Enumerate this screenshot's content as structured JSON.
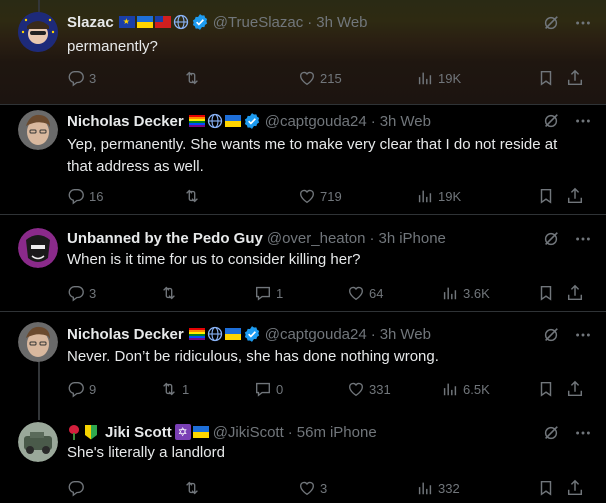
{
  "tweets": [
    {
      "name": "Slazac",
      "handle": "@TrueSlazac",
      "time": "3h",
      "source": "Web",
      "text": "permanently?",
      "replies": "3",
      "retweets": "",
      "quotes": "",
      "likes": "215",
      "views": "19K"
    },
    {
      "name": "Nicholas Decker",
      "handle": "@captgouda24",
      "time": "3h",
      "source": "Web",
      "text": "Yep, permanently. She wants me to make very clear that I do not reside at that address as well.",
      "replies": "16",
      "retweets": "",
      "quotes": "",
      "likes": "719",
      "views": "19K"
    },
    {
      "name": "Unbanned by the Pedo Guy",
      "handle": "@over_heaton",
      "time": "3h",
      "source": "iPhone",
      "text": "When is it time for us to consider killing her?",
      "replies": "3",
      "retweets": "",
      "quotes": "1",
      "likes": "64",
      "views": "3.6K"
    },
    {
      "name": "Nicholas Decker",
      "handle": "@captgouda24",
      "time": "3h",
      "source": "Web",
      "text": "Never. Don’t be ridiculous, she has done nothing wrong.",
      "replies": "9",
      "retweets": "1",
      "quotes": "0",
      "likes": "331",
      "views": "6.5K"
    },
    {
      "name": "Jiki Scott",
      "handle": "@JikiScott",
      "time": "56m",
      "source": "iPhone",
      "text": "She's literally a landlord",
      "replies": "",
      "retweets": "",
      "quotes": "",
      "likes": "3",
      "views": "332"
    }
  ],
  "separator": "·",
  "icons": {
    "reply": "reply-icon",
    "retweet": "retweet-icon",
    "quote": "quote-icon",
    "like": "like-icon",
    "views": "views-icon",
    "bookmark": "bookmark-icon",
    "share": "share-icon",
    "grok": "grok-icon",
    "more": "more-icon"
  },
  "colors": {
    "background": "#000000",
    "text": "#e7e9ea",
    "muted": "#71767b",
    "verified": "#1d9bf0",
    "divider": "#2f3336"
  }
}
